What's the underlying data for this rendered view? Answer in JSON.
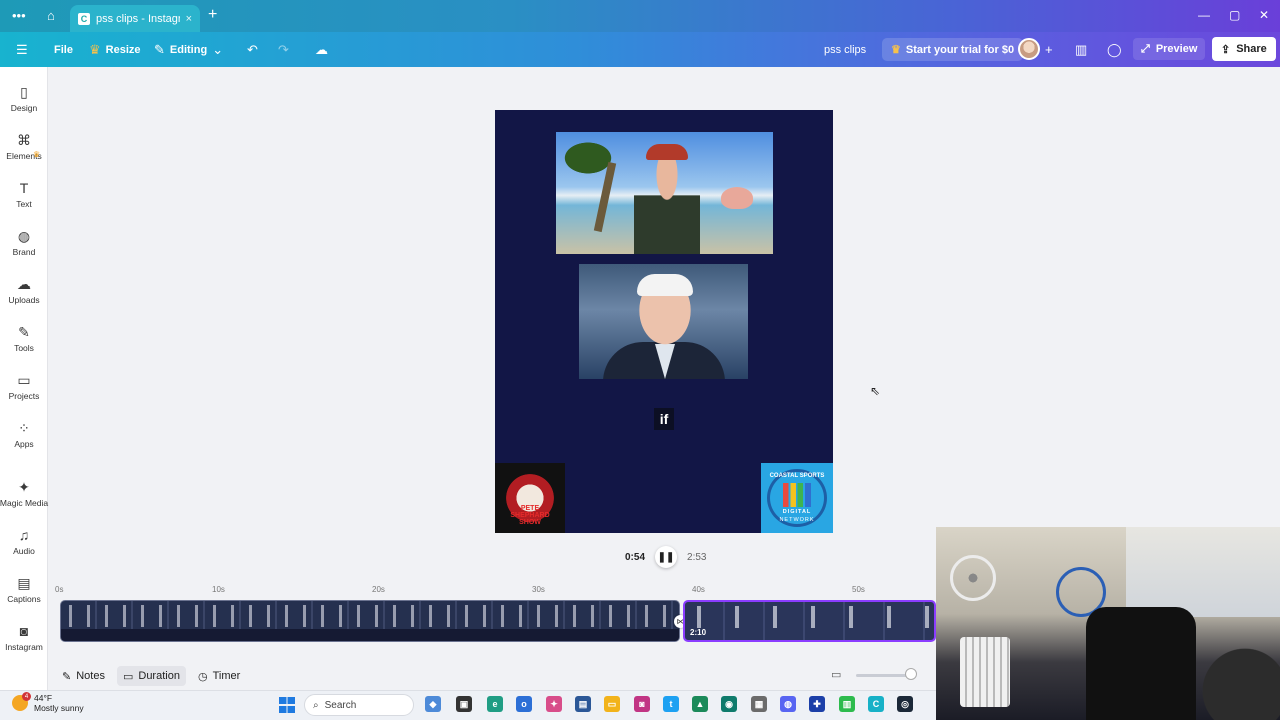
{
  "browser": {
    "tab_title": "pss clips - Instagra...",
    "tab_close": "×",
    "new_tab": "+",
    "menu_dots": "•••",
    "window_controls": [
      "—",
      "▢",
      "✕"
    ]
  },
  "toolbar": {
    "menu_icon": "hamburger-icon",
    "file_label": "File",
    "resize_label": "Resize",
    "editing_label": "Editing",
    "project_name": "pss clips",
    "trial_label": "Start your trial for $0",
    "preview_label": "Preview",
    "share_label": "Share"
  },
  "sidebar": {
    "items": [
      {
        "label": "Design",
        "icon": "layout-icon",
        "glyph": "▯"
      },
      {
        "label": "Elements",
        "icon": "shapes-icon",
        "glyph": "⌘"
      },
      {
        "label": "Text",
        "icon": "text-icon",
        "glyph": "T"
      },
      {
        "label": "Brand",
        "icon": "brand-icon",
        "glyph": "◍"
      },
      {
        "label": "Uploads",
        "icon": "cloud-upload-icon",
        "glyph": "☁"
      },
      {
        "label": "Tools",
        "icon": "pen-icon",
        "glyph": "✎"
      },
      {
        "label": "Projects",
        "icon": "folder-icon",
        "glyph": "▭"
      },
      {
        "label": "Apps",
        "icon": "apps-icon",
        "glyph": "⁘"
      },
      {
        "label": "Magic Media",
        "icon": "magic-media-icon",
        "glyph": "✦"
      },
      {
        "label": "Audio",
        "icon": "music-icon",
        "glyph": "♫"
      },
      {
        "label": "Captions",
        "icon": "captions-icon",
        "glyph": "▤"
      },
      {
        "label": "Instagram",
        "icon": "instagram-icon",
        "glyph": "◙"
      }
    ]
  },
  "canvas": {
    "caption_text": "if",
    "logo_left_text": "PETE SHEPHARD SHOW",
    "logo_right_text_top": "COASTAL SPORTS",
    "logo_right_text_mid": "DIGITAL",
    "logo_right_text_bottom": "NETWORK"
  },
  "playback": {
    "current_time": "0:54",
    "total_time": "2:53",
    "pause_glyph": "❚❚"
  },
  "timeline": {
    "ticks": [
      "0s",
      "10s",
      "20s",
      "30s",
      "40s",
      "50s"
    ],
    "clip2_duration": "2:10"
  },
  "footer": {
    "notes_label": "Notes",
    "duration_label": "Duration",
    "timer_label": "Timer"
  },
  "taskbar": {
    "temperature": "44°F",
    "weather_text": "Mostly sunny",
    "notification_count": "4",
    "search_label": "Search"
  },
  "colors": {
    "design_background": "#121646",
    "accent_purple": "#8b3dff",
    "toolbar_start": "#18b3cf",
    "toolbar_end": "#6c48dc"
  }
}
